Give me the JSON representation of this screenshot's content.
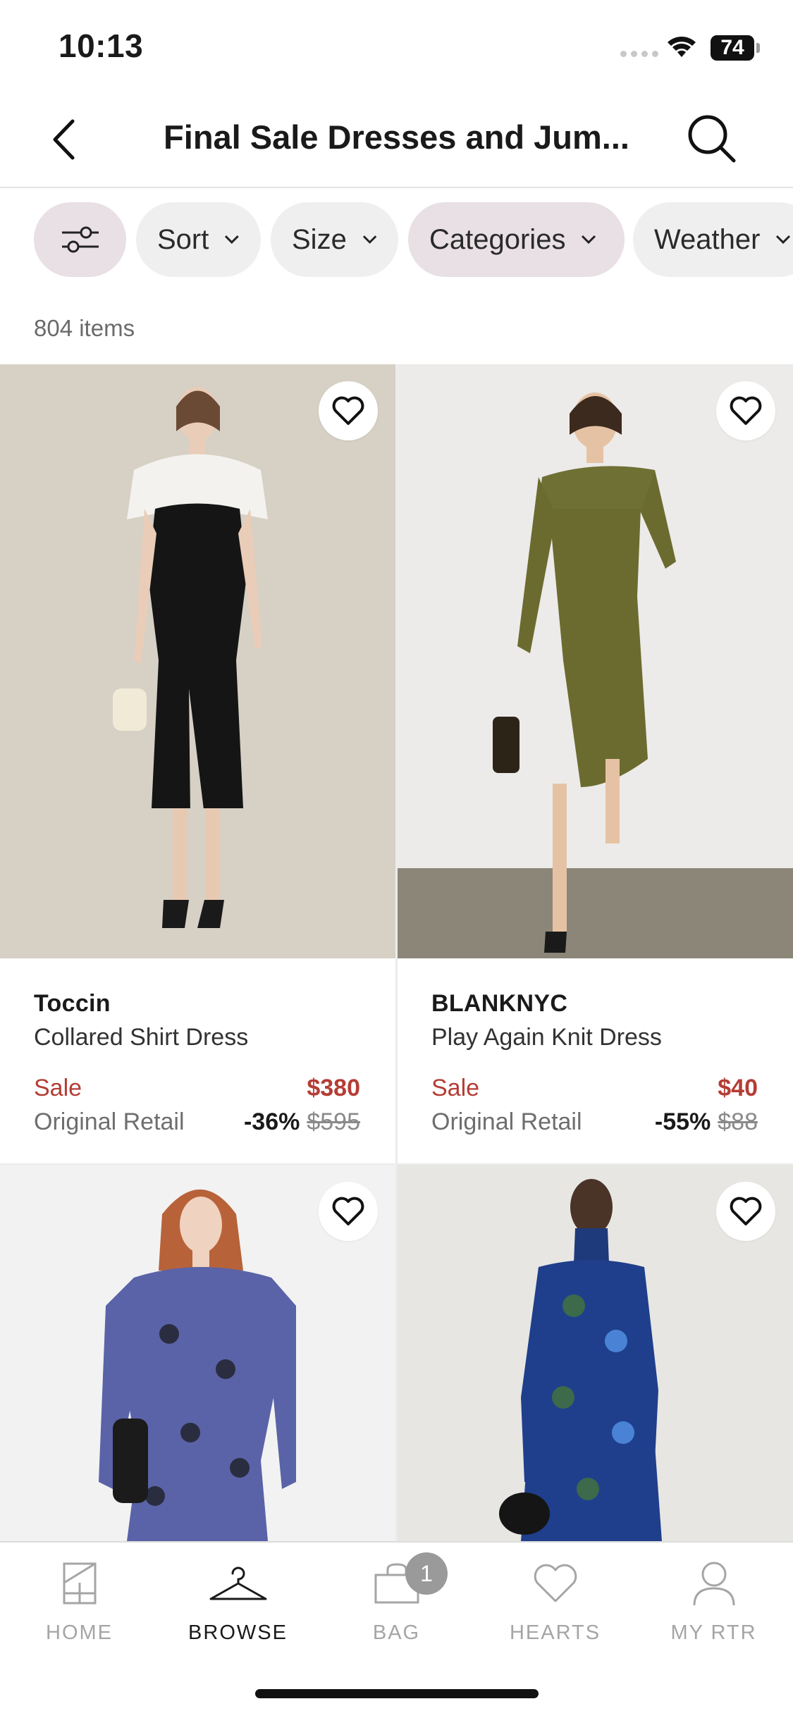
{
  "status": {
    "time": "10:13",
    "battery": "74"
  },
  "header": {
    "title": "Final Sale Dresses and Jum...",
    "back_icon": "chevron-left-icon",
    "search_icon": "search-icon"
  },
  "filters": {
    "items": [
      {
        "label": "",
        "icon": "sliders-icon",
        "active": true
      },
      {
        "label": "Sort",
        "active": false
      },
      {
        "label": "Size",
        "active": false
      },
      {
        "label": "Categories",
        "active": true
      },
      {
        "label": "Weather",
        "active": false
      }
    ]
  },
  "results": {
    "count": "804 items"
  },
  "products": [
    {
      "brand": "Toccin",
      "name": "Collared Shirt Dress",
      "sale_label": "Sale",
      "sale_price": "$380",
      "orig_label": "Original Retail",
      "discount": "-36%",
      "orig_price": "$595"
    },
    {
      "brand": "BLANKNYC",
      "name": "Play Again Knit Dress",
      "sale_label": "Sale",
      "sale_price": "$40",
      "orig_label": "Original Retail",
      "discount": "-55%",
      "orig_price": "$88"
    },
    {
      "brand": "",
      "name": ""
    },
    {
      "brand": "",
      "name": ""
    }
  ],
  "tabbar": {
    "items": [
      {
        "label": "HOME",
        "icon": "home-icon"
      },
      {
        "label": "BROWSE",
        "icon": "hanger-icon"
      },
      {
        "label": "BAG",
        "icon": "bag-icon"
      },
      {
        "label": "HEARTS",
        "icon": "heart-icon"
      },
      {
        "label": "MY RTR",
        "icon": "person-icon"
      }
    ],
    "active": "BROWSE",
    "bag_badge": "1"
  },
  "colors": {
    "sale": "#b43d35",
    "chip_active": "#e8e0e4",
    "chip": "#efefef"
  }
}
